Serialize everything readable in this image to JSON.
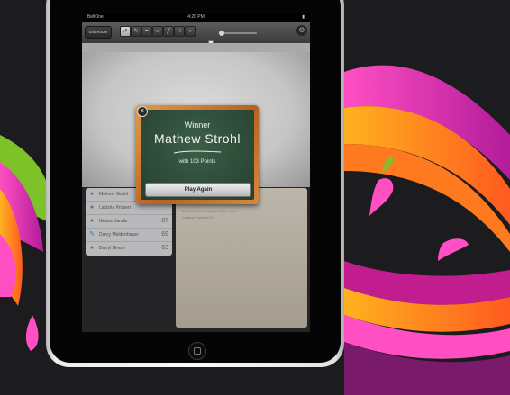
{
  "status_bar": {
    "carrier": "BellOne",
    "time": "4:20 PM",
    "battery": ""
  },
  "toolbar": {
    "exit_label": "Exit Room",
    "tools": [
      {
        "icon": "select-icon",
        "glyph": "↗"
      },
      {
        "icon": "pencil-icon",
        "glyph": "✎"
      },
      {
        "icon": "brush-icon",
        "glyph": "✒"
      },
      {
        "icon": "eraser-icon",
        "glyph": "▭"
      },
      {
        "icon": "line-icon",
        "glyph": "╱"
      },
      {
        "icon": "rectangle-icon",
        "glyph": "□"
      },
      {
        "icon": "circle-icon",
        "glyph": "○"
      }
    ]
  },
  "popup": {
    "title": "Winner",
    "winner_name": "Mathew Strohl",
    "score_text": "with 103 Points",
    "button_label": "Play Again",
    "close_glyph": "×"
  },
  "players": [
    {
      "name": "Mathew Strohl",
      "score": "",
      "icon": "user-icon",
      "color": "#3a86c8"
    },
    {
      "name": "Lakisha Probert",
      "score": "",
      "icon": "user-icon",
      "color": "#7a7a80"
    },
    {
      "name": "Nelson Jandis",
      "score": "87",
      "icon": "user-icon",
      "color": "#7a7a80"
    },
    {
      "name": "Darcy Moldenhauer",
      "score": "69",
      "icon": "pencil-icon",
      "color": "#3a86c8"
    },
    {
      "name": "Darryl Bevan",
      "score": "63",
      "icon": "user-icon",
      "color": "#7a7a80"
    }
  ],
  "chat": {
    "lines": [
      "Mathew Strohl has joined the room",
      "Lakisha Probert: !!!!"
    ]
  },
  "colors": {
    "chalkboard": "#2f4d3b",
    "frame": "#c87430",
    "accent_blue": "#3a86c8"
  }
}
